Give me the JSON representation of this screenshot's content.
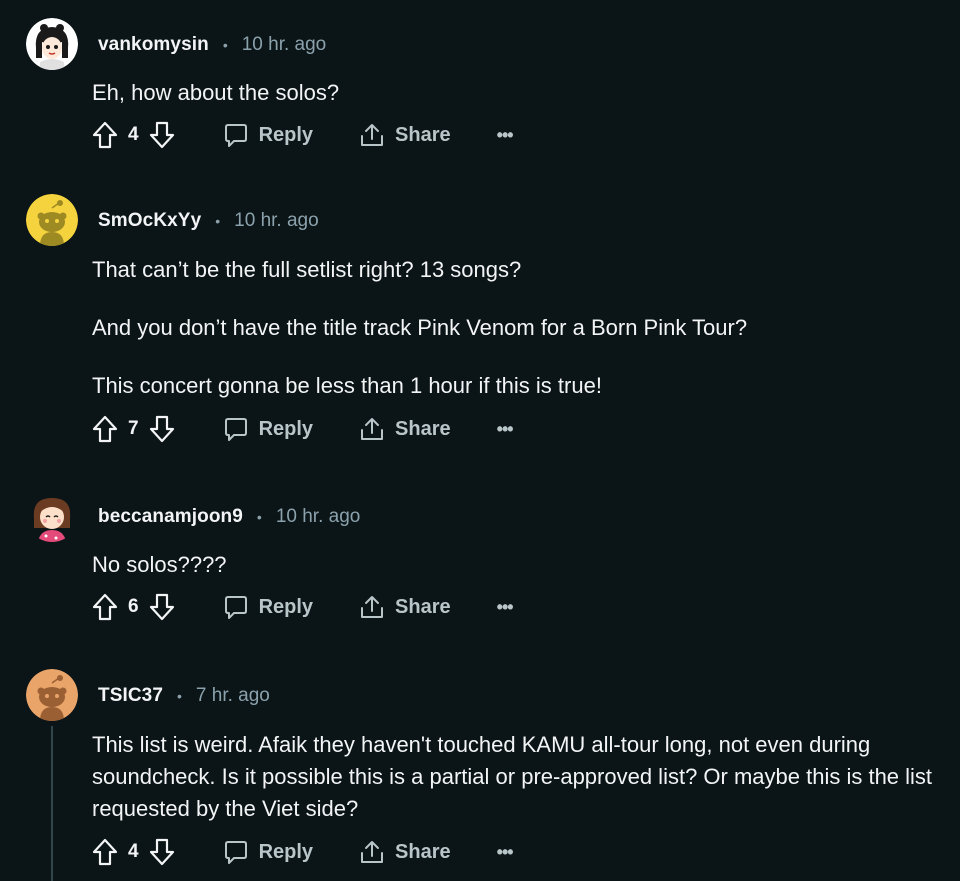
{
  "comments": [
    {
      "username": "vankomysin",
      "time": "10 hr. ago",
      "body": [
        "Eh, how about the solos?"
      ],
      "score": "4",
      "reply_label": "Reply",
      "share_label": "Share",
      "more_label": "•••"
    },
    {
      "username": "SmOcKxYy",
      "time": "10 hr. ago",
      "body": [
        "That can’t be the full setlist right? 13 songs?",
        "And you don’t have the title track Pink Venom for a Born Pink Tour?",
        "This concert gonna be less than 1 hour if this is true!"
      ],
      "score": "7",
      "reply_label": "Reply",
      "share_label": "Share",
      "more_label": "•••"
    },
    {
      "username": "beccanamjoon9",
      "time": "10 hr. ago",
      "body": [
        "No solos????"
      ],
      "score": "6",
      "reply_label": "Reply",
      "share_label": "Share",
      "more_label": "•••"
    },
    {
      "username": "TSIC37",
      "time": "7 hr. ago",
      "body": [
        "This list is weird. Afaik they haven't touched KAMU all-tour long, not even during soundcheck. Is it possible this is a partial or pre-approved list? Or maybe this is the list requested by the Viet side?"
      ],
      "score": "4",
      "reply_label": "Reply",
      "share_label": "Share",
      "more_label": "•••"
    }
  ],
  "separator": "•",
  "colors": {
    "background": "#0b1416",
    "text": "#f2f4f5",
    "muted": "#8ba2ad",
    "action": "#b8c5c9",
    "avatar_yellow": "#f5d33f",
    "avatar_orange": "#e9a46a"
  }
}
